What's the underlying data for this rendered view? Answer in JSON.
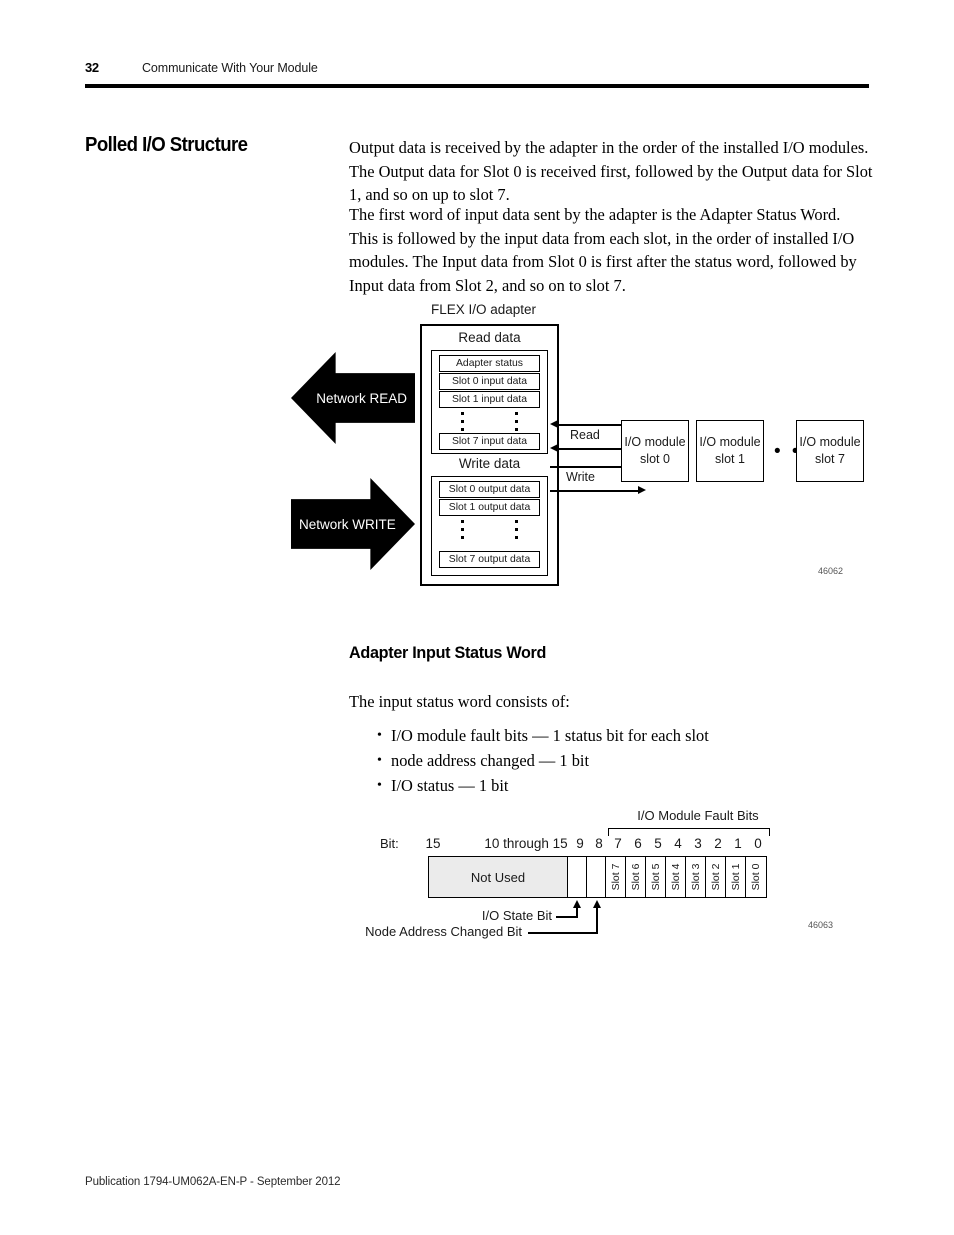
{
  "header": {
    "page_number": "32",
    "chapter_title": "Communicate With Your Module"
  },
  "section": {
    "heading": "Polled I/O Structure",
    "paragraph_1": "Output data is received by the adapter in the order of the installed I/O modules. The Output data for Slot 0 is received first, followed by the Output data for Slot 1, and so on up to slot 7.",
    "paragraph_2": "The first word of input data sent by the adapter is the Adapter Status Word. This is followed by the input data from each slot, in the order of installed I/O modules. The Input data from Slot 0 is first after the status word, followed by Input data from Slot 2, and so on to slot 7."
  },
  "diagram_polled_io": {
    "adapter_caption": "FLEX I/O adapter",
    "read_data_label": "Read data",
    "write_data_label": "Write data",
    "read_cells": [
      "Adapter status",
      "Slot 0 input data",
      "Slot 1 input data",
      "Slot 7 input data"
    ],
    "write_cells": [
      "Slot 0 output data",
      "Slot 1 output data",
      "Slot 7 output data"
    ],
    "network_read_label": "Network READ",
    "network_write_label": "Network WRITE",
    "read_line_label": "Read",
    "write_line_label": "Write",
    "io_modules": [
      {
        "line1": "I/O module",
        "line2": "slot 0"
      },
      {
        "line1": "I/O module",
        "line2": "slot 1"
      },
      {
        "line1": "I/O module",
        "line2": "slot 7"
      }
    ],
    "ellipsis": "• • •",
    "figure_label": "46062"
  },
  "subsection": {
    "heading": "Adapter Input Status Word",
    "intro": "The input status word consists of:",
    "bullets": [
      "I/O module fault bits — 1 status bit for each slot",
      "node address changed — 1 bit",
      "I/O status — 1 bit"
    ]
  },
  "diagram_status_word": {
    "fault_bits_caption": "I/O Module Fault Bits",
    "bit_word_label": "Bit:",
    "bit_numbers": [
      "15",
      "10 through 15",
      "9",
      "8",
      "7",
      "6",
      "5",
      "4",
      "3",
      "2",
      "1",
      "0"
    ],
    "not_used_label": "Not Used",
    "slot_labels": [
      "Slot 7",
      "Slot 6",
      "Slot 5",
      "Slot 4",
      "Slot 3",
      "Slot 2",
      "Slot 1",
      "Slot 0"
    ],
    "callout_io_state": "I/O State Bit",
    "callout_node_address": "Node Address Changed Bit",
    "figure_label": "46063"
  },
  "footer": {
    "publication": "Publication 1794-UM062A-EN-P - September 2012"
  }
}
